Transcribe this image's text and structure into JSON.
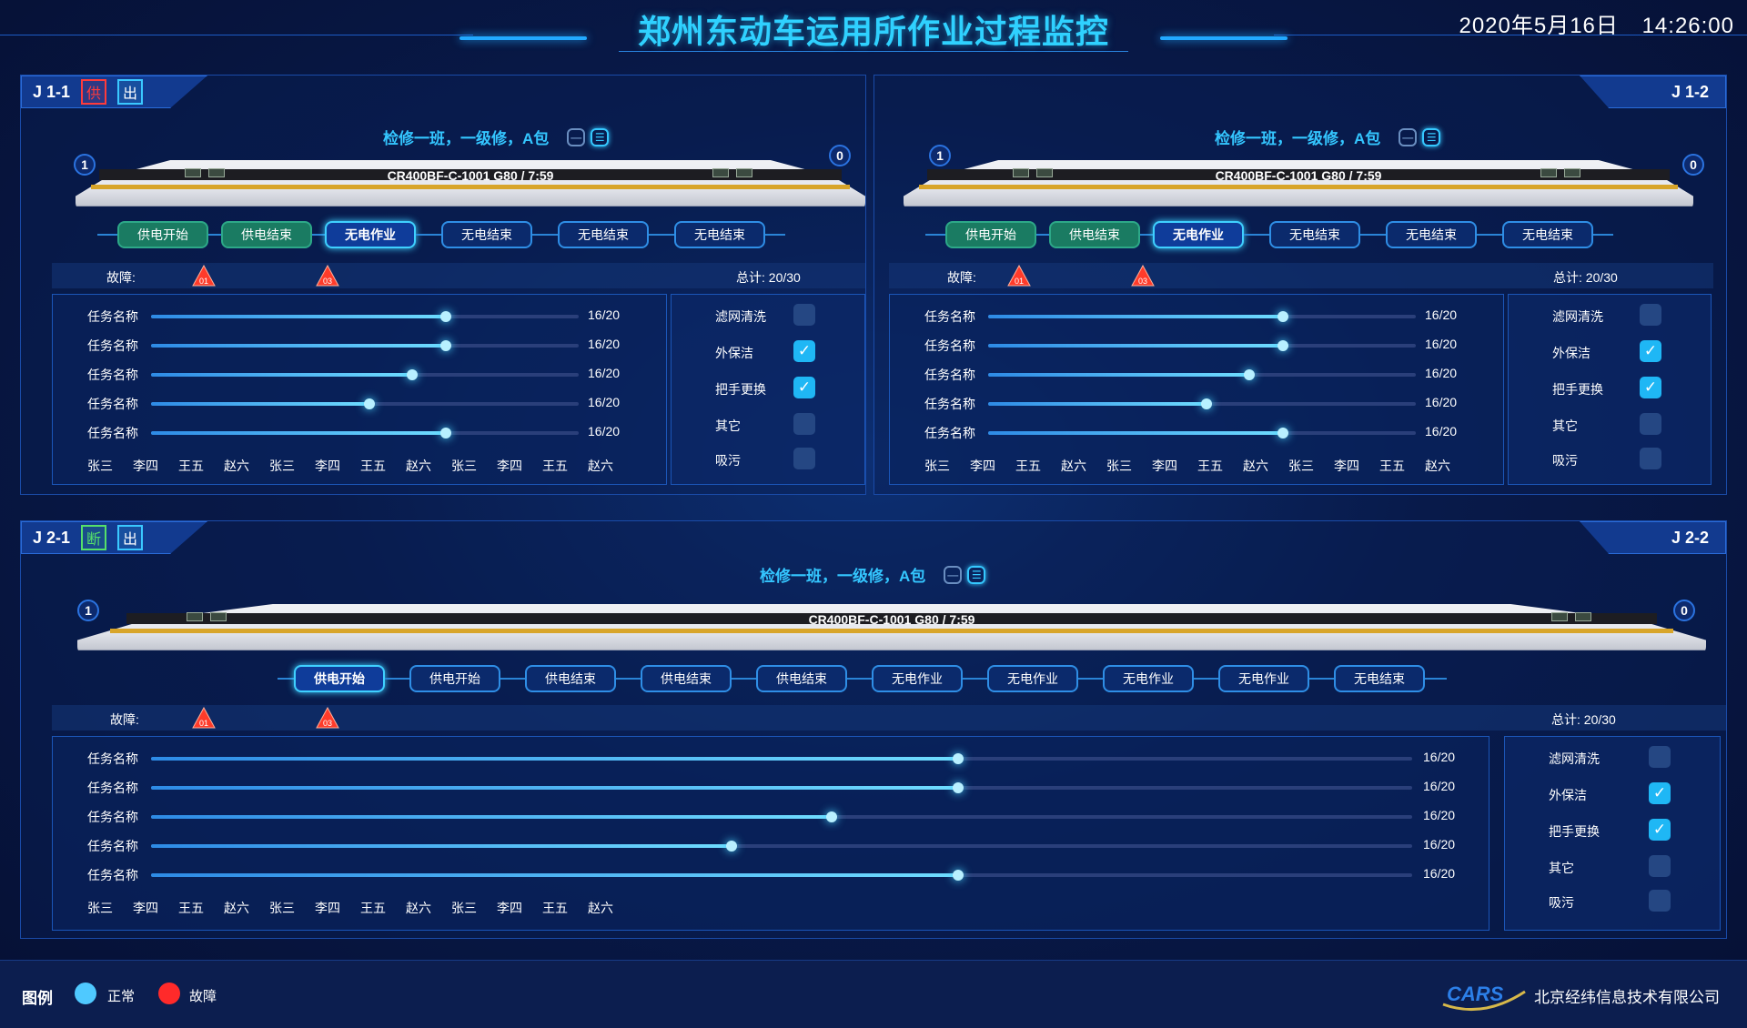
{
  "header": {
    "title": "郑州东动车运用所作业过程监控",
    "date": "2020年5月16日",
    "time": "14:26:00"
  },
  "panels": {
    "j11": {
      "tab": "J 1-1",
      "tags": [
        "供",
        "出"
      ],
      "crew": "检修一班，一级修，A包",
      "start_num": "1",
      "end_num": "0",
      "train_label": "CR400BF-C-1001  G80 / 7:59",
      "steps": [
        "供电开始",
        "供电结束",
        "无电作业",
        "无电结束",
        "无电结束",
        "无电结束"
      ],
      "fault_label": "故障:",
      "fault_icons": [
        "01",
        "03"
      ],
      "total": "总计:   20/30",
      "tasks": [
        {
          "name": "任务名称",
          "value": "16/20",
          "progress": 0.69
        },
        {
          "name": "任务名称",
          "value": "16/20",
          "progress": 0.69
        },
        {
          "name": "任务名称",
          "value": "16/20",
          "progress": 0.61
        },
        {
          "name": "任务名称",
          "value": "16/20",
          "progress": 0.51
        },
        {
          "name": "任务名称",
          "value": "16/20",
          "progress": 0.69
        }
      ],
      "names": [
        "张三",
        "李四",
        "王五",
        "赵六",
        "张三",
        "李四",
        "王五",
        "赵六",
        "张三",
        "李四",
        "王五",
        "赵六"
      ],
      "checks": [
        {
          "label": "滤网清洗",
          "checked": false
        },
        {
          "label": "外保洁",
          "checked": true
        },
        {
          "label": "把手更换",
          "checked": true
        },
        {
          "label": "其它",
          "checked": false
        },
        {
          "label": "吸污",
          "checked": false
        }
      ]
    },
    "j12": {
      "tab": "J 1-2",
      "crew": "检修一班，一级修，A包",
      "start_num": "1",
      "end_num": "0",
      "train_label": "CR400BF-C-1001  G80 / 7:59",
      "steps": [
        "供电开始",
        "供电结束",
        "无电作业",
        "无电结束",
        "无电结束",
        "无电结束"
      ],
      "fault_label": "故障:",
      "fault_icons": [
        "01",
        "03"
      ],
      "total": "总计:   20/30",
      "tasks": [
        {
          "name": "任务名称",
          "value": "16/20",
          "progress": 0.69
        },
        {
          "name": "任务名称",
          "value": "16/20",
          "progress": 0.69
        },
        {
          "name": "任务名称",
          "value": "16/20",
          "progress": 0.61
        },
        {
          "name": "任务名称",
          "value": "16/20",
          "progress": 0.51
        },
        {
          "name": "任务名称",
          "value": "16/20",
          "progress": 0.69
        }
      ],
      "names": [
        "张三",
        "李四",
        "王五",
        "赵六",
        "张三",
        "李四",
        "王五",
        "赵六",
        "张三",
        "李四",
        "王五",
        "赵六"
      ],
      "checks": [
        {
          "label": "滤网清洗",
          "checked": false
        },
        {
          "label": "外保洁",
          "checked": true
        },
        {
          "label": "把手更换",
          "checked": true
        },
        {
          "label": "其它",
          "checked": false
        },
        {
          "label": "吸污",
          "checked": false
        }
      ]
    },
    "j21": {
      "tab": "J 2-1",
      "tags": [
        "断",
        "出"
      ],
      "tab_right": "J 2-2",
      "crew": "检修一班，一级修，A包",
      "start_num": "1",
      "end_num": "0",
      "train_label": "CR400BF-C-1001  G80 / 7:59",
      "steps": [
        "供电开始",
        "供电开始",
        "供电结束",
        "供电结束",
        "供电结束",
        "无电作业",
        "无电作业",
        "无电作业",
        "无电作业",
        "无电结束"
      ],
      "fault_label": "故障:",
      "fault_icons": [
        "01",
        "03"
      ],
      "total": "总计:   20/30",
      "tasks": [
        {
          "name": "任务名称",
          "value": "16/20",
          "progress": 0.64
        },
        {
          "name": "任务名称",
          "value": "16/20",
          "progress": 0.64
        },
        {
          "name": "任务名称",
          "value": "16/20",
          "progress": 0.54
        },
        {
          "name": "任务名称",
          "value": "16/20",
          "progress": 0.46
        },
        {
          "name": "任务名称",
          "value": "16/20",
          "progress": 0.64
        }
      ],
      "names": [
        "张三",
        "李四",
        "王五",
        "赵六",
        "张三",
        "李四",
        "王五",
        "赵六",
        "张三",
        "李四",
        "王五",
        "赵六"
      ],
      "checks": [
        {
          "label": "滤网清洗",
          "checked": false
        },
        {
          "label": "外保洁",
          "checked": true
        },
        {
          "label": "把手更换",
          "checked": true
        },
        {
          "label": "其它",
          "checked": false
        },
        {
          "label": "吸污",
          "checked": false
        }
      ]
    }
  },
  "footer": {
    "legend_title": "图例",
    "legend": [
      {
        "label": "正常",
        "color": "#4fc9ff"
      },
      {
        "label": "故障",
        "color": "#ff2a2a"
      }
    ],
    "logo_text": "CARS",
    "company": "北京经纬信息技术有限公司"
  },
  "colors": {
    "accent": "#2fd1ff",
    "normal": "#4fc9ff",
    "fault": "#ff2a2a",
    "step_green": "#1a7b62"
  }
}
